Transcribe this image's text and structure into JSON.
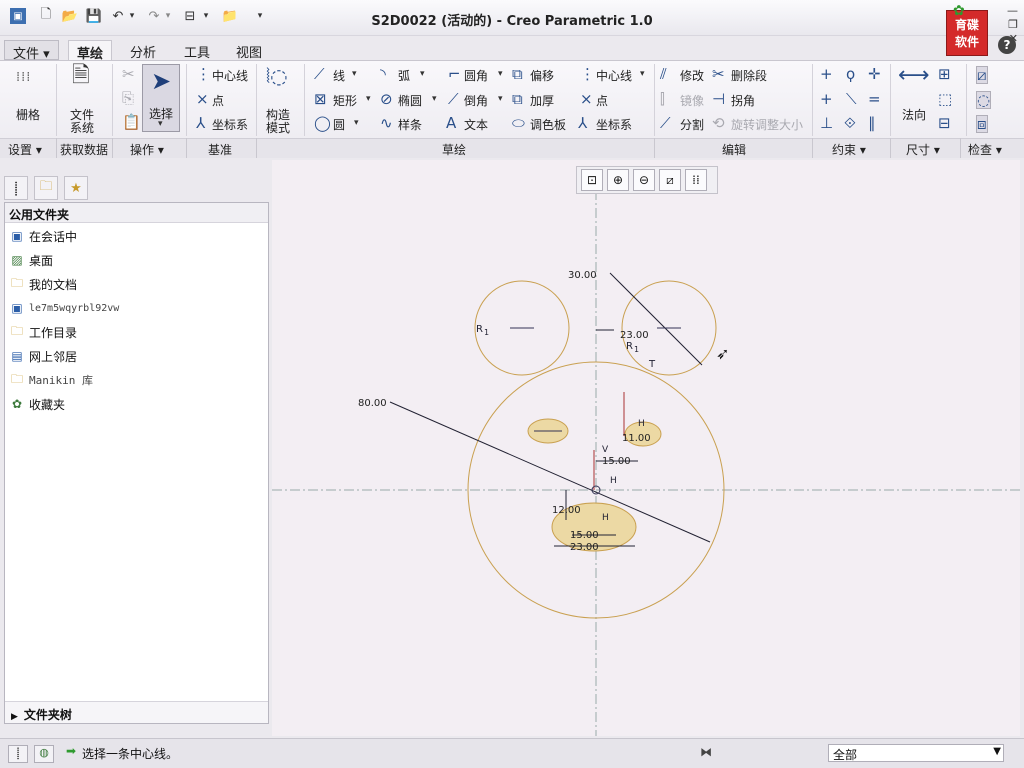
{
  "window": {
    "title": "S2D0022 (活动的) - Creo Parametric 1.0"
  },
  "logo": {
    "line1": "育碟",
    "line2": "软件"
  },
  "tabs": [
    {
      "label": "文件 ▾"
    },
    {
      "label": "草绘"
    },
    {
      "label": "分析"
    },
    {
      "label": "工具"
    },
    {
      "label": "视图"
    }
  ],
  "ribbon": {
    "grid": "栅格",
    "file_system_1": "文件",
    "file_system_2": "系统",
    "select": "选择",
    "centerline": "中心线",
    "point": "点",
    "csys": "坐标系",
    "construction_1": "构造",
    "construction_2": "模式",
    "line": "线",
    "arc": "弧",
    "fillet": "圆角",
    "offset": "偏移",
    "rectangle": "矩形",
    "ellipse": "椭圆",
    "chamfer": "倒角",
    "thicken": "加厚",
    "circle": "圆",
    "spline": "样条",
    "text": "文本",
    "palette": "调色板",
    "centerline2": "中心线",
    "point2": "点",
    "csys2": "坐标系",
    "modify": "修改",
    "delete_segment": "删除段",
    "mirror": "镜像",
    "corner": "拐角",
    "divide": "分割",
    "rotate_resize": "旋转调整大小",
    "normal": "法向"
  },
  "groups": {
    "setup": "设置 ▾",
    "get_data": "获取数据",
    "operations": "操作 ▾",
    "datum": "基准",
    "sketching": "草绘",
    "editing": "编辑",
    "constrain": "约束 ▾",
    "dimension": "尺寸 ▾",
    "inspect": "检查 ▾"
  },
  "panel": {
    "header": "公用文件夹",
    "items": [
      {
        "label": "在会话中"
      },
      {
        "label": "桌面"
      },
      {
        "label": "我的文档"
      },
      {
        "label": "le7m5wqyrbl92vw"
      },
      {
        "label": "工作目录"
      },
      {
        "label": "网上邻居"
      },
      {
        "label": "Manikin 库"
      },
      {
        "label": "收藏夹"
      }
    ],
    "footer": "文件夹树"
  },
  "sketch": {
    "dims": {
      "d30_top": "30.00",
      "d23": "23.00",
      "d80": "80.00",
      "d15_mid": "15.00",
      "d11": "11.00",
      "d12": "12.00",
      "d15_low": "15.00",
      "d23_low": "23.00"
    },
    "constraint_labels": {
      "r1_left": "R",
      "r1_left_sub": "1",
      "r1_right": "R",
      "r1_right_sub": "1",
      "t": "T",
      "h1": "H",
      "h2": "H",
      "h3": "H",
      "v": "V"
    }
  },
  "status": {
    "message": "选择一条中心线。",
    "filter": "全部"
  }
}
